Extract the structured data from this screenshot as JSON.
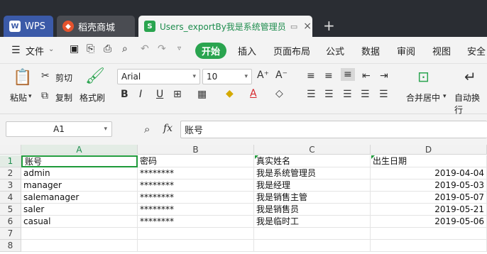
{
  "tabs": [
    {
      "label": "WPS"
    },
    {
      "label": "稻壳商城"
    },
    {
      "label": "Users_exportBy我是系统管理员"
    }
  ],
  "menu": {
    "file": "文件",
    "home": "开始",
    "items": [
      "插入",
      "页面布局",
      "公式",
      "数据",
      "审阅",
      "视图",
      "安全"
    ]
  },
  "ribbon": {
    "paste": "粘贴",
    "cut": "剪切",
    "copy": "复制",
    "format_painter": "格式刷",
    "font": "Arial",
    "size": "10",
    "merge": "合并居中",
    "wrap": "自动换行"
  },
  "formula": {
    "cell_ref": "A1",
    "fx": "fx",
    "value": "账号"
  },
  "sheet": {
    "columns": [
      "A",
      "B",
      "C",
      "D"
    ],
    "rows": [
      "1",
      "2",
      "3",
      "4",
      "5",
      "6",
      "7",
      "8"
    ],
    "data": [
      [
        "账号",
        "密码",
        "真实姓名",
        "出生日期"
      ],
      [
        "admin",
        "********",
        "我是系统管理员",
        "2019-04-04"
      ],
      [
        "manager",
        "********",
        "我是经理",
        "2019-05-03"
      ],
      [
        "salemanager",
        "********",
        "我是销售主管",
        "2019-05-07"
      ],
      [
        "saler",
        "********",
        "我是销售员",
        "2019-05-21"
      ],
      [
        "casual",
        "********",
        "我是临时工",
        "2019-05-06"
      ],
      [
        "",
        "",
        "",
        ""
      ],
      [
        "",
        "",
        "",
        ""
      ]
    ]
  },
  "colors": {
    "accent": "#2aa44f",
    "titlebar": "#2a2d33",
    "selection": "#1e9a3a"
  }
}
